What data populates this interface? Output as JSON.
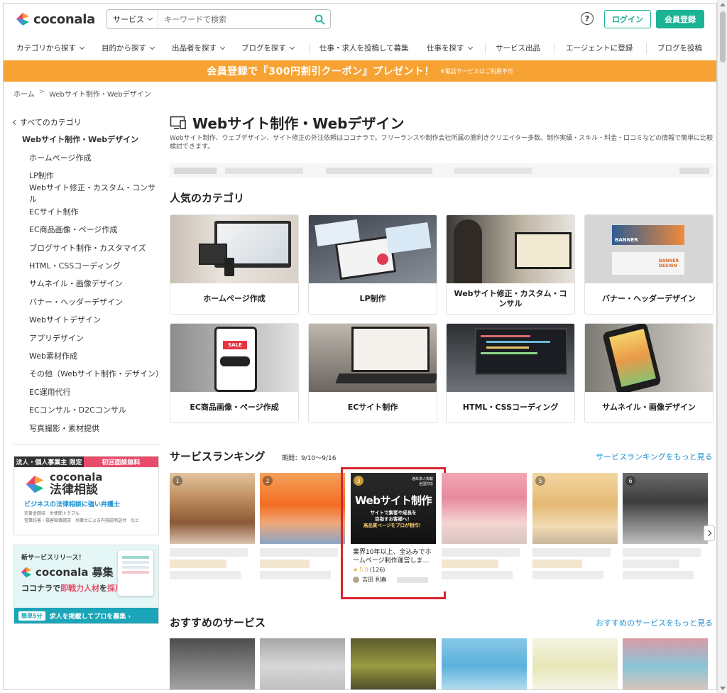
{
  "header": {
    "logo_text": "coconala",
    "search_category": "サービス",
    "search_placeholder": "キーワードで検索",
    "help_label": "?",
    "login_label": "ログイン",
    "signup_label": "会員登録"
  },
  "nav": {
    "items": [
      "カテゴリから探す",
      "目的から探す",
      "出品者を探す",
      "ブログを探す",
      "仕事・求人を投稿して募集",
      "仕事を探す",
      "サービス出品",
      "エージェントに登録",
      "ブログを投稿"
    ]
  },
  "banner": {
    "main": "会員登録で『300円割引クーポン』プレゼント！",
    "sub": "※電話サービスはご利用不可"
  },
  "breadcrumb": {
    "home": "ホーム",
    "sep": ">",
    "current": "Webサイト制作・Webデザイン"
  },
  "sidebar": {
    "back": "すべてのカテゴリ",
    "current": "Webサイト制作・Webデザイン",
    "items": [
      "ホームページ作成",
      "LP制作",
      "Webサイト修正・カスタム・コンサル",
      "ECサイト制作",
      "EC商品画像・ページ作成",
      "ブログサイト制作・カスタマイズ",
      "HTML・CSSコーディング",
      "サムネイル・画像デザイン",
      "バナー・ヘッダーデザイン",
      "Webサイトデザイン",
      "アプリデザイン",
      "Web素材作成",
      "その他（Webサイト制作・デザイン）",
      "EC運用代行",
      "ECコンサル・D2Cコンサル",
      "写真撮影・素材提供"
    ]
  },
  "ads": {
    "law_tag": "法人・個人事業主 限定",
    "law_badge": "初回面談無料",
    "law_brand": "coconala",
    "law_title": "法律相談",
    "law_catch": "ビジネスの法律相談に強い弁護士",
    "law_small_1": "売掛金回収　労使間トラブル",
    "law_small_2": "営業妨害・損害賠償請求　弁護士による内容証明送付　など",
    "recruit_new": "新サービスリリース！",
    "recruit_brand": "coconala 募集",
    "recruit_catch_1": "ココナラで",
    "recruit_catch_2": "即戦力人材",
    "recruit_catch_3": "を",
    "recruit_catch_4": "採用",
    "recruit_badge": "簡単5分",
    "recruit_cta": "求人を掲載してプロを募集 ›"
  },
  "main": {
    "title": "Webサイト制作・Webデザイン",
    "description": "Webサイト制作、ウェブデザイン、サイト修正の外注依頼はココナラで。フリーランスや制作会社所属の腕利きクリエイター多数。制作実績・スキル・料金・口コミなどの情報で簡単に比較検討できます。",
    "popular_heading": "人気のカテゴリ",
    "categories": [
      {
        "label": "ホームページ作成"
      },
      {
        "label": "LP制作"
      },
      {
        "label": "Webサイト修正・カスタム・コンサル"
      },
      {
        "label": "バナー・ヘッダーデザイン",
        "img_text_1": "BANNER",
        "img_text_2": "BANNER DESIGN"
      },
      {
        "label": "EC商品画像・ページ作成",
        "img_text_1": "SALE"
      },
      {
        "label": "ECサイト制作"
      },
      {
        "label": "HTML・CSSコーディング"
      },
      {
        "label": "サムネイル・画像デザイン"
      }
    ],
    "ranking_heading": "サービスランキング",
    "ranking_period": "期間：9/10〜9/16",
    "ranking_more": "サービスランキングをもっと見る",
    "ranking_numbers": [
      "1",
      "2",
      "3",
      "4",
      "5",
      "6"
    ],
    "featured": {
      "rank": "3",
      "img_tag_1": "通年求人掲載",
      "img_tag_2": "全国対応",
      "img_title": "Webサイト制作",
      "img_sub_1": "サイトで集客や成長を",
      "img_sub_2": "目指すお客様へ！",
      "img_sub_3": "高品質ページをプロが制作！",
      "title": "業界10年以上、全込みでホームページ制作運営しま…",
      "rating": "5.0",
      "reviews": "(126)",
      "seller": "吉田 利春"
    },
    "recommend_heading": "おすすめのサービス",
    "recommend_more": "おすすめのサービスをもっと見る"
  },
  "colors": {
    "brand_green": "#1ab394",
    "banner_orange": "#f7a333",
    "link_blue": "#1a8fd0",
    "highlight_red": "#d8252e"
  }
}
